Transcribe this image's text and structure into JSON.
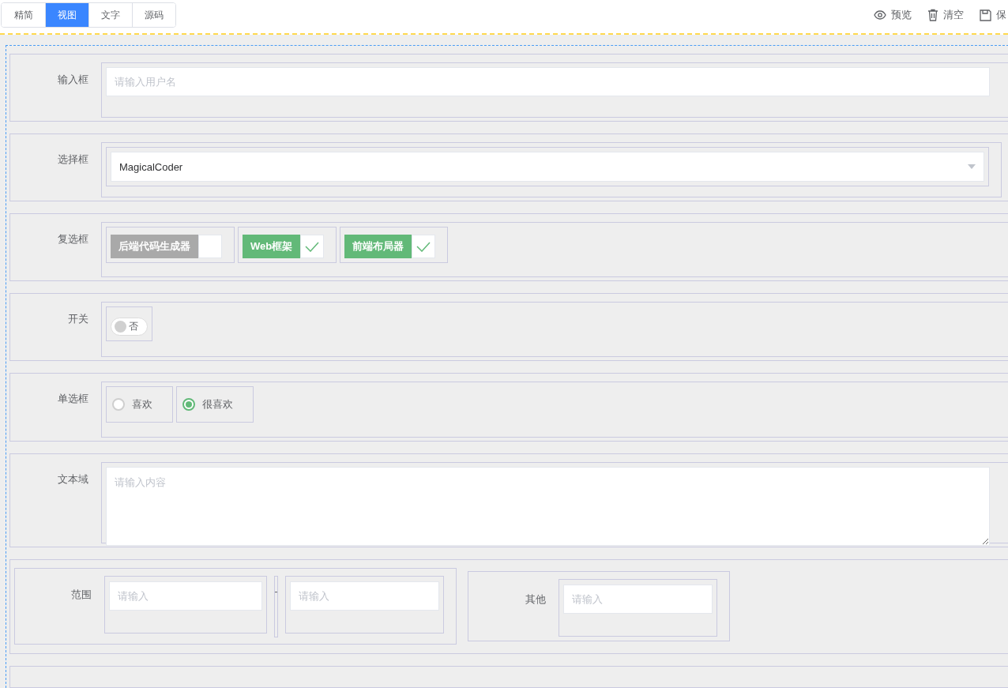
{
  "tabs": [
    {
      "label": "精简",
      "selected": false
    },
    {
      "label": "视图",
      "selected": true
    },
    {
      "label": "文字",
      "selected": false
    },
    {
      "label": "源码",
      "selected": false
    }
  ],
  "actions": [
    {
      "kind": "preview",
      "label": "预览"
    },
    {
      "kind": "clear",
      "label": "清空"
    },
    {
      "kind": "save",
      "label": "保"
    }
  ],
  "rows": [
    {
      "kind": "input",
      "label": "输入框",
      "placeholder": "请输入用户名"
    },
    {
      "kind": "select",
      "label": "选择框",
      "value": "MagicalCoder"
    },
    {
      "kind": "checkboxes",
      "label": "复选框",
      "options": [
        {
          "label": "后端代码生成器",
          "checked": false
        },
        {
          "label": "Web框架",
          "checked": true
        },
        {
          "label": "前端布局器",
          "checked": true
        }
      ]
    },
    {
      "kind": "switch",
      "label": "开关",
      "on": false,
      "text": "否"
    },
    {
      "kind": "radios",
      "label": "单选框",
      "options": [
        {
          "label": "喜欢",
          "selected": false
        },
        {
          "label": "很喜欢",
          "selected": true
        }
      ]
    },
    {
      "kind": "textarea",
      "label": "文本域",
      "placeholder": "请输入内容"
    },
    {
      "kind": "range",
      "label": "范围",
      "placeholder_from": "请输入",
      "separator": "-",
      "placeholder_to": "请输入",
      "other_label": "其他",
      "other_placeholder": "请输入"
    }
  ]
}
